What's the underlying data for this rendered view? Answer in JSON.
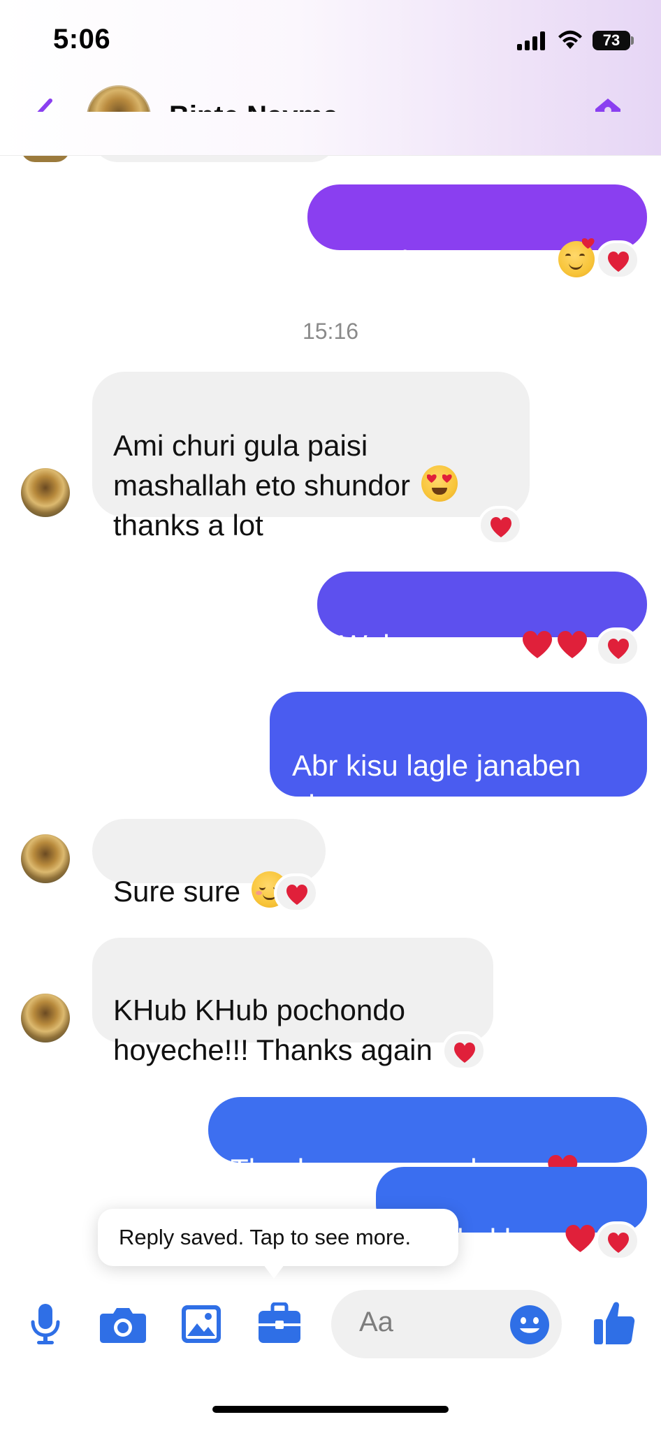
{
  "status_bar": {
    "time": "5:06",
    "battery": "73",
    "icons": [
      "signal-icon",
      "wifi-icon",
      "battery-icon"
    ]
  },
  "header": {
    "back_icon": "chevron-left-icon",
    "contact_name": "Binte Nayma",
    "tag_icon": "tag-icon",
    "accent_color": "#8a3ff0"
  },
  "messages": [
    {
      "direction": "out",
      "text": "Our pleasure apu",
      "emoji": "smiling-face-with-hearts",
      "reaction": "heart"
    },
    {
      "type": "timestamp",
      "text": "15:16"
    },
    {
      "direction": "in",
      "text": "Ami churi gula paisi\nmashallah eto shundor",
      "text2": "thanks a lot",
      "emoji": "heart-eyes",
      "reaction": "heart"
    },
    {
      "direction": "out",
      "text": "Welcome apu",
      "emoji": "red-heart x2",
      "reaction": "heart"
    },
    {
      "direction": "out",
      "text": "Abr kisu lagle janaben\nplz apu"
    },
    {
      "direction": "in",
      "text": "Sure sure",
      "emoji": "smiling-face",
      "reaction": "heart"
    },
    {
      "direction": "in",
      "text": "KHub KHub pochondo\nhoyeche!!! Thanks again",
      "reaction": "heart"
    },
    {
      "direction": "out",
      "text": "Thank you so much apu",
      "emoji": "red-heart"
    },
    {
      "direction": "out",
      "text": "Vlo thakben",
      "emoji": "red-heart",
      "reaction": "heart"
    }
  ],
  "tooltip": {
    "text": "Reply saved. Tap to see more."
  },
  "composer": {
    "placeholder": "Aa",
    "tools": [
      "microphone-icon",
      "camera-icon",
      "image-icon",
      "briefcase-icon"
    ],
    "emoji_icon": "emoji-icon",
    "like_icon": "thumbs-up-icon",
    "tool_color": "#2f6fe6"
  },
  "colors": {
    "incoming_bubble": "#f0f0f0",
    "outgoing_top": "#8a3ff0",
    "outgoing_bottom": "#3a6ef0",
    "reaction_heart": "#e0203a"
  }
}
